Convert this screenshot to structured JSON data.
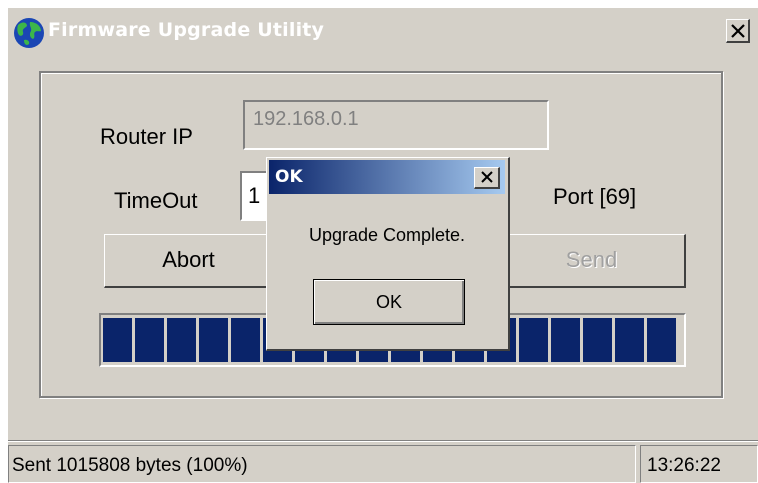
{
  "window": {
    "title": "Firmware Upgrade Utility",
    "close_label": "×"
  },
  "form": {
    "router_ip_label": "Router IP",
    "router_ip_value": "192.168.0.1",
    "timeout_label": "TimeOut",
    "timeout_value": "1",
    "port_label": "Port [69]",
    "abort_label": "Abort",
    "send_label": "Send"
  },
  "progress": {
    "percent": 100,
    "block_color": "#0a246a"
  },
  "status": {
    "message": "Sent 1015808 bytes (100%)",
    "time": "13:26:22"
  },
  "dialog": {
    "title": "OK",
    "message": "Upgrade Complete.",
    "ok_label": "OK"
  },
  "icons": {
    "app": "globe-icon",
    "close": "close-icon"
  }
}
